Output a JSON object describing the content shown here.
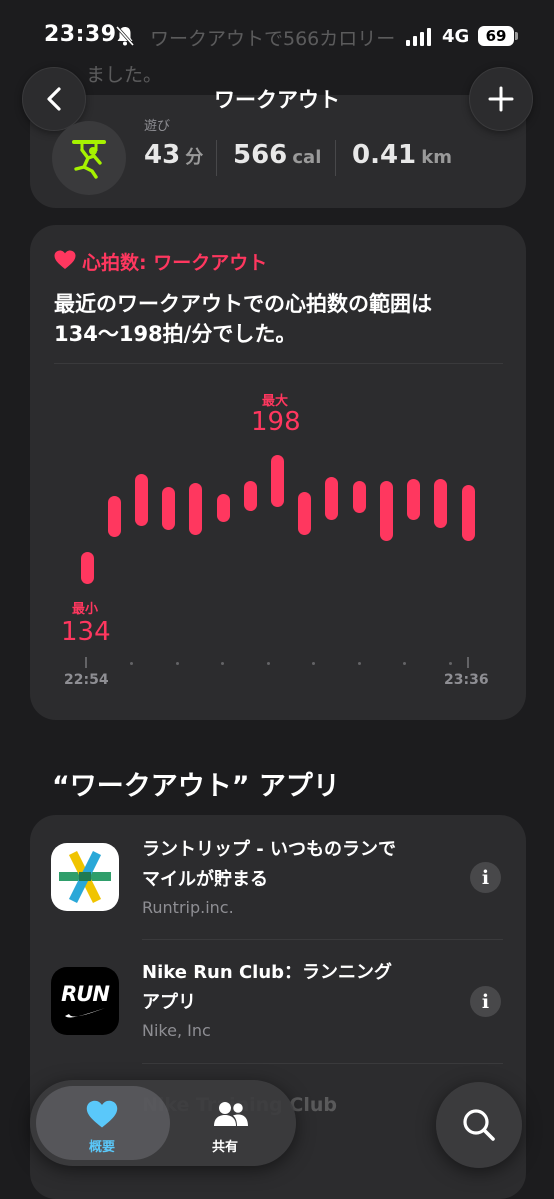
{
  "status_bar": {
    "time": "23:39",
    "network": "4G",
    "battery": "69"
  },
  "behind_text": {
    "line1": "ワークアウトで566カロリー",
    "line2": "ました。"
  },
  "nav": {
    "title": "ワークアウト"
  },
  "workout_summary": {
    "activity": "遊び",
    "duration": "43",
    "duration_unit": "分",
    "calories": "566",
    "calories_unit": "cal",
    "distance": "0.41",
    "distance_unit": "km"
  },
  "heart_rate": {
    "title": "心拍数: ワークアウト",
    "description": "最近のワークアウトでの心拍数の範囲は134〜198拍/分でした。",
    "max_label": "最大",
    "max_value": "198",
    "min_label": "最小",
    "min_value": "134",
    "start_time": "22:54",
    "end_time": "23:36"
  },
  "chart_data": {
    "type": "range-bar",
    "y_unit": "bpm",
    "ylim": [
      130,
      202
    ],
    "x": [
      "22:54",
      "23:36"
    ],
    "ranges": [
      [
        135,
        150
      ],
      [
        157,
        176
      ],
      [
        162,
        186
      ],
      [
        160,
        180
      ],
      [
        158,
        182
      ],
      [
        164,
        177
      ],
      [
        169,
        183
      ],
      [
        171,
        195
      ],
      [
        158,
        178
      ],
      [
        165,
        185
      ],
      [
        168,
        183
      ],
      [
        155,
        183
      ],
      [
        165,
        184
      ],
      [
        161,
        184
      ],
      [
        155,
        181
      ]
    ]
  },
  "apps_section": {
    "title": "“ワークアウト” アプリ",
    "apps": [
      {
        "name_line1": "ラントリップ - いつものランで",
        "name_line2": "マイルが貯まる",
        "developer": "Runtrip.inc."
      },
      {
        "name_line1": "Nike Run Club：ランニング",
        "name_line2": "アプリ",
        "developer": "Nike, Inc"
      },
      {
        "name_line1": "Nike Training Club",
        "name_line2": "",
        "developer": ""
      }
    ]
  },
  "nike_logo_text": "RUN",
  "tab_bar": {
    "summary_label": "概要",
    "sharing_label": "共有"
  },
  "colors": {
    "accent": "#ff375f",
    "activity_green": "#a6f200",
    "tab_active": "#5ac8fa"
  }
}
